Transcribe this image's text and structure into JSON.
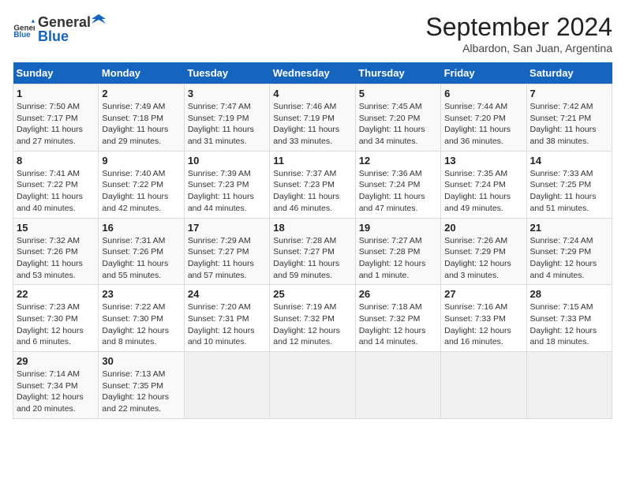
{
  "header": {
    "logo_general": "General",
    "logo_blue": "Blue",
    "title": "September 2024",
    "location": "Albardon, San Juan, Argentina"
  },
  "days_of_week": [
    "Sunday",
    "Monday",
    "Tuesday",
    "Wednesday",
    "Thursday",
    "Friday",
    "Saturday"
  ],
  "weeks": [
    [
      {
        "num": "1",
        "sunrise": "7:50 AM",
        "sunset": "7:17 PM",
        "daylight": "11 hours and 27 minutes."
      },
      {
        "num": "2",
        "sunrise": "7:49 AM",
        "sunset": "7:18 PM",
        "daylight": "11 hours and 29 minutes."
      },
      {
        "num": "3",
        "sunrise": "7:47 AM",
        "sunset": "7:19 PM",
        "daylight": "11 hours and 31 minutes."
      },
      {
        "num": "4",
        "sunrise": "7:46 AM",
        "sunset": "7:19 PM",
        "daylight": "11 hours and 33 minutes."
      },
      {
        "num": "5",
        "sunrise": "7:45 AM",
        "sunset": "7:20 PM",
        "daylight": "11 hours and 34 minutes."
      },
      {
        "num": "6",
        "sunrise": "7:44 AM",
        "sunset": "7:20 PM",
        "daylight": "11 hours and 36 minutes."
      },
      {
        "num": "7",
        "sunrise": "7:42 AM",
        "sunset": "7:21 PM",
        "daylight": "11 hours and 38 minutes."
      }
    ],
    [
      {
        "num": "8",
        "sunrise": "7:41 AM",
        "sunset": "7:22 PM",
        "daylight": "11 hours and 40 minutes."
      },
      {
        "num": "9",
        "sunrise": "7:40 AM",
        "sunset": "7:22 PM",
        "daylight": "11 hours and 42 minutes."
      },
      {
        "num": "10",
        "sunrise": "7:39 AM",
        "sunset": "7:23 PM",
        "daylight": "11 hours and 44 minutes."
      },
      {
        "num": "11",
        "sunrise": "7:37 AM",
        "sunset": "7:23 PM",
        "daylight": "11 hours and 46 minutes."
      },
      {
        "num": "12",
        "sunrise": "7:36 AM",
        "sunset": "7:24 PM",
        "daylight": "11 hours and 47 minutes."
      },
      {
        "num": "13",
        "sunrise": "7:35 AM",
        "sunset": "7:24 PM",
        "daylight": "11 hours and 49 minutes."
      },
      {
        "num": "14",
        "sunrise": "7:33 AM",
        "sunset": "7:25 PM",
        "daylight": "11 hours and 51 minutes."
      }
    ],
    [
      {
        "num": "15",
        "sunrise": "7:32 AM",
        "sunset": "7:26 PM",
        "daylight": "11 hours and 53 minutes."
      },
      {
        "num": "16",
        "sunrise": "7:31 AM",
        "sunset": "7:26 PM",
        "daylight": "11 hours and 55 minutes."
      },
      {
        "num": "17",
        "sunrise": "7:29 AM",
        "sunset": "7:27 PM",
        "daylight": "11 hours and 57 minutes."
      },
      {
        "num": "18",
        "sunrise": "7:28 AM",
        "sunset": "7:27 PM",
        "daylight": "11 hours and 59 minutes."
      },
      {
        "num": "19",
        "sunrise": "7:27 AM",
        "sunset": "7:28 PM",
        "daylight": "12 hours and 1 minute."
      },
      {
        "num": "20",
        "sunrise": "7:26 AM",
        "sunset": "7:29 PM",
        "daylight": "12 hours and 3 minutes."
      },
      {
        "num": "21",
        "sunrise": "7:24 AM",
        "sunset": "7:29 PM",
        "daylight": "12 hours and 4 minutes."
      }
    ],
    [
      {
        "num": "22",
        "sunrise": "7:23 AM",
        "sunset": "7:30 PM",
        "daylight": "12 hours and 6 minutes."
      },
      {
        "num": "23",
        "sunrise": "7:22 AM",
        "sunset": "7:30 PM",
        "daylight": "12 hours and 8 minutes."
      },
      {
        "num": "24",
        "sunrise": "7:20 AM",
        "sunset": "7:31 PM",
        "daylight": "12 hours and 10 minutes."
      },
      {
        "num": "25",
        "sunrise": "7:19 AM",
        "sunset": "7:32 PM",
        "daylight": "12 hours and 12 minutes."
      },
      {
        "num": "26",
        "sunrise": "7:18 AM",
        "sunset": "7:32 PM",
        "daylight": "12 hours and 14 minutes."
      },
      {
        "num": "27",
        "sunrise": "7:16 AM",
        "sunset": "7:33 PM",
        "daylight": "12 hours and 16 minutes."
      },
      {
        "num": "28",
        "sunrise": "7:15 AM",
        "sunset": "7:33 PM",
        "daylight": "12 hours and 18 minutes."
      }
    ],
    [
      {
        "num": "29",
        "sunrise": "7:14 AM",
        "sunset": "7:34 PM",
        "daylight": "12 hours and 20 minutes."
      },
      {
        "num": "30",
        "sunrise": "7:13 AM",
        "sunset": "7:35 PM",
        "daylight": "12 hours and 22 minutes."
      },
      null,
      null,
      null,
      null,
      null
    ]
  ],
  "labels": {
    "sunrise": "Sunrise:",
    "sunset": "Sunset:",
    "daylight": "Daylight:"
  }
}
